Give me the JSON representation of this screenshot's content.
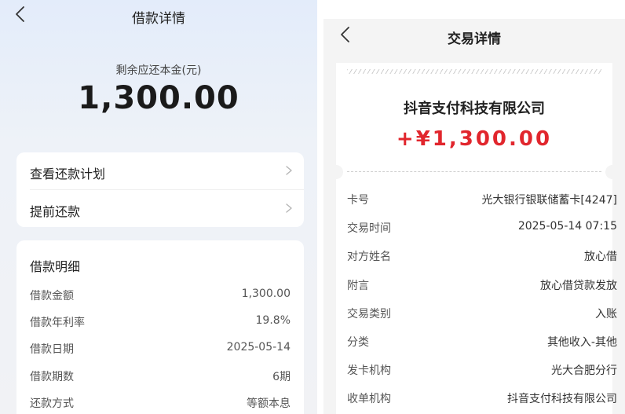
{
  "loan": {
    "title": "借款详情",
    "remain_label": "剩余应还本金(元)",
    "remain_amount": "1,300.00",
    "menu": [
      {
        "label": "查看还款计划"
      },
      {
        "label": "提前还款"
      }
    ],
    "details_title": "借款明细",
    "details": [
      {
        "key": "借款金额",
        "value": "1,300.00"
      },
      {
        "key": "借款年利率",
        "value": "19.8%"
      },
      {
        "key": "借款日期",
        "value": "2025-05-14"
      },
      {
        "key": "借款期数",
        "value": "6期"
      },
      {
        "key": "还款方式",
        "value": "等额本息"
      }
    ]
  },
  "transaction": {
    "title": "交易详情",
    "merchant": "抖音支付科技有限公司",
    "amount": "+¥1,300.00",
    "amount_color": "#e1262d",
    "rows": [
      {
        "key": "卡号",
        "value": "光大银行银联储蓄卡[4247]"
      },
      {
        "key": "交易时间",
        "value": "2025-05-14 07:15"
      },
      {
        "key": "对方姓名",
        "value": "放心借"
      },
      {
        "key": "附言",
        "value": "放心借贷款发放"
      },
      {
        "key": "交易类别",
        "value": "入账"
      },
      {
        "key": "分类",
        "value": "其他收入-其他"
      },
      {
        "key": "发卡机构",
        "value": "光大合肥分行"
      },
      {
        "key": "收单机构",
        "value": "抖音支付科技有限公司"
      }
    ]
  },
  "icons": {
    "back": "chevron-left-icon",
    "menu_arrow": "chevron-right-icon"
  }
}
